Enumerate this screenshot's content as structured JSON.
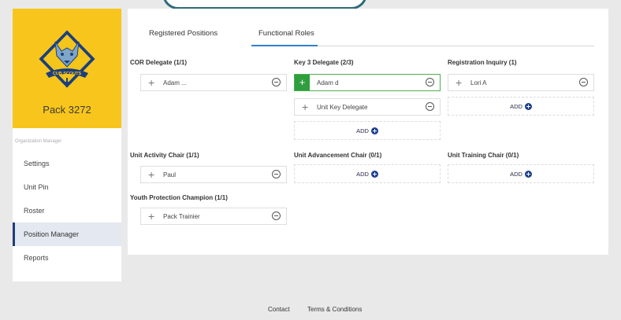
{
  "sidebar": {
    "pack_name": "Pack 3272",
    "logo_text": "CUB SCOUTS",
    "section_label": "Organization Manager",
    "items": [
      {
        "label": "Settings"
      },
      {
        "label": "Unit Pin"
      },
      {
        "label": "Roster"
      },
      {
        "label": "Position Manager",
        "active": true
      },
      {
        "label": "Reports"
      }
    ]
  },
  "tabs": [
    {
      "label": "Registered Positions"
    },
    {
      "label": "Functional Roles",
      "active": true
    }
  ],
  "roles": {
    "cor_delegate": {
      "title": "COR Delegate (1/1)",
      "members": [
        "Adam ..."
      ]
    },
    "key3_delegate": {
      "title": "Key 3 Delegate (2/3)",
      "members": [
        "Adam d",
        "Unit Key Delegate"
      ],
      "add_label": "ADD"
    },
    "registration_inquiry": {
      "title": "Registration Inquiry (1)",
      "members": [
        "Lori A"
      ],
      "add_label": "ADD"
    },
    "unit_activity_chair": {
      "title": "Unit Activity Chair (1/1)",
      "members": [
        "Paul"
      ]
    },
    "unit_advancement_chair": {
      "title": "Unit Advancement Chair (0/1)",
      "add_label": "ADD"
    },
    "unit_training_chair": {
      "title": "Unit Training Chair (0/1)",
      "add_label": "ADD"
    },
    "youth_protection": {
      "title": "Youth Protection Champion (1/1)",
      "members": [
        "Pack Trainier"
      ]
    }
  },
  "footer": {
    "contact": "Contact",
    "terms": "Terms & Conditions"
  },
  "colors": {
    "brand_yellow": "#f8c51c",
    "accent_blue": "#2f7fcf",
    "add_blue": "#1c3f8f",
    "highlight_green": "#2e9e3e"
  }
}
